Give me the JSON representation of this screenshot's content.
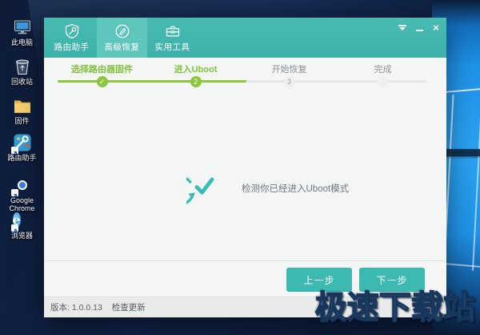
{
  "app": {
    "tabs": [
      {
        "label": "路由助手",
        "active": false
      },
      {
        "label": "高级恢复",
        "active": true
      },
      {
        "label": "实用工具",
        "active": false
      }
    ],
    "window_controls": {
      "close_glyph": "×"
    },
    "wizard": {
      "steps": [
        {
          "label": "选择路由器固件",
          "marker": "✓",
          "state": "done"
        },
        {
          "label": "进入Uboot",
          "marker": "2",
          "state": "current"
        },
        {
          "label": "开始恢复",
          "marker": "3",
          "state": "pending"
        },
        {
          "label": "完成",
          "marker": "",
          "state": "pending"
        }
      ]
    },
    "status_message": "检测你已经进入Uboot模式",
    "buttons": {
      "prev": "上一步",
      "next": "下一步"
    },
    "footer": {
      "version": "版本: 1.0.0.13",
      "check_update": "检查更新"
    }
  },
  "desktop": {
    "icons": [
      {
        "label": "此电脑"
      },
      {
        "label": "回收站"
      },
      {
        "label": "固件"
      },
      {
        "label": "路由助手"
      },
      {
        "label": "Google Chrome"
      },
      {
        "label": "浏览器"
      }
    ],
    "watermark": "极速下载站"
  },
  "colors": {
    "header_teal": "#43b6ad",
    "active_tab_teal": "#5fc6bc",
    "step_green": "#8dc63f",
    "button_teal": "#3cb9b0",
    "body_bg": "#f4f6f5",
    "footer_bg": "#e9ebeb",
    "watermark_blue": "#3f70a8",
    "desktop_navy": "#0e1c38",
    "winlogo_blue": "#2ba2f2"
  }
}
